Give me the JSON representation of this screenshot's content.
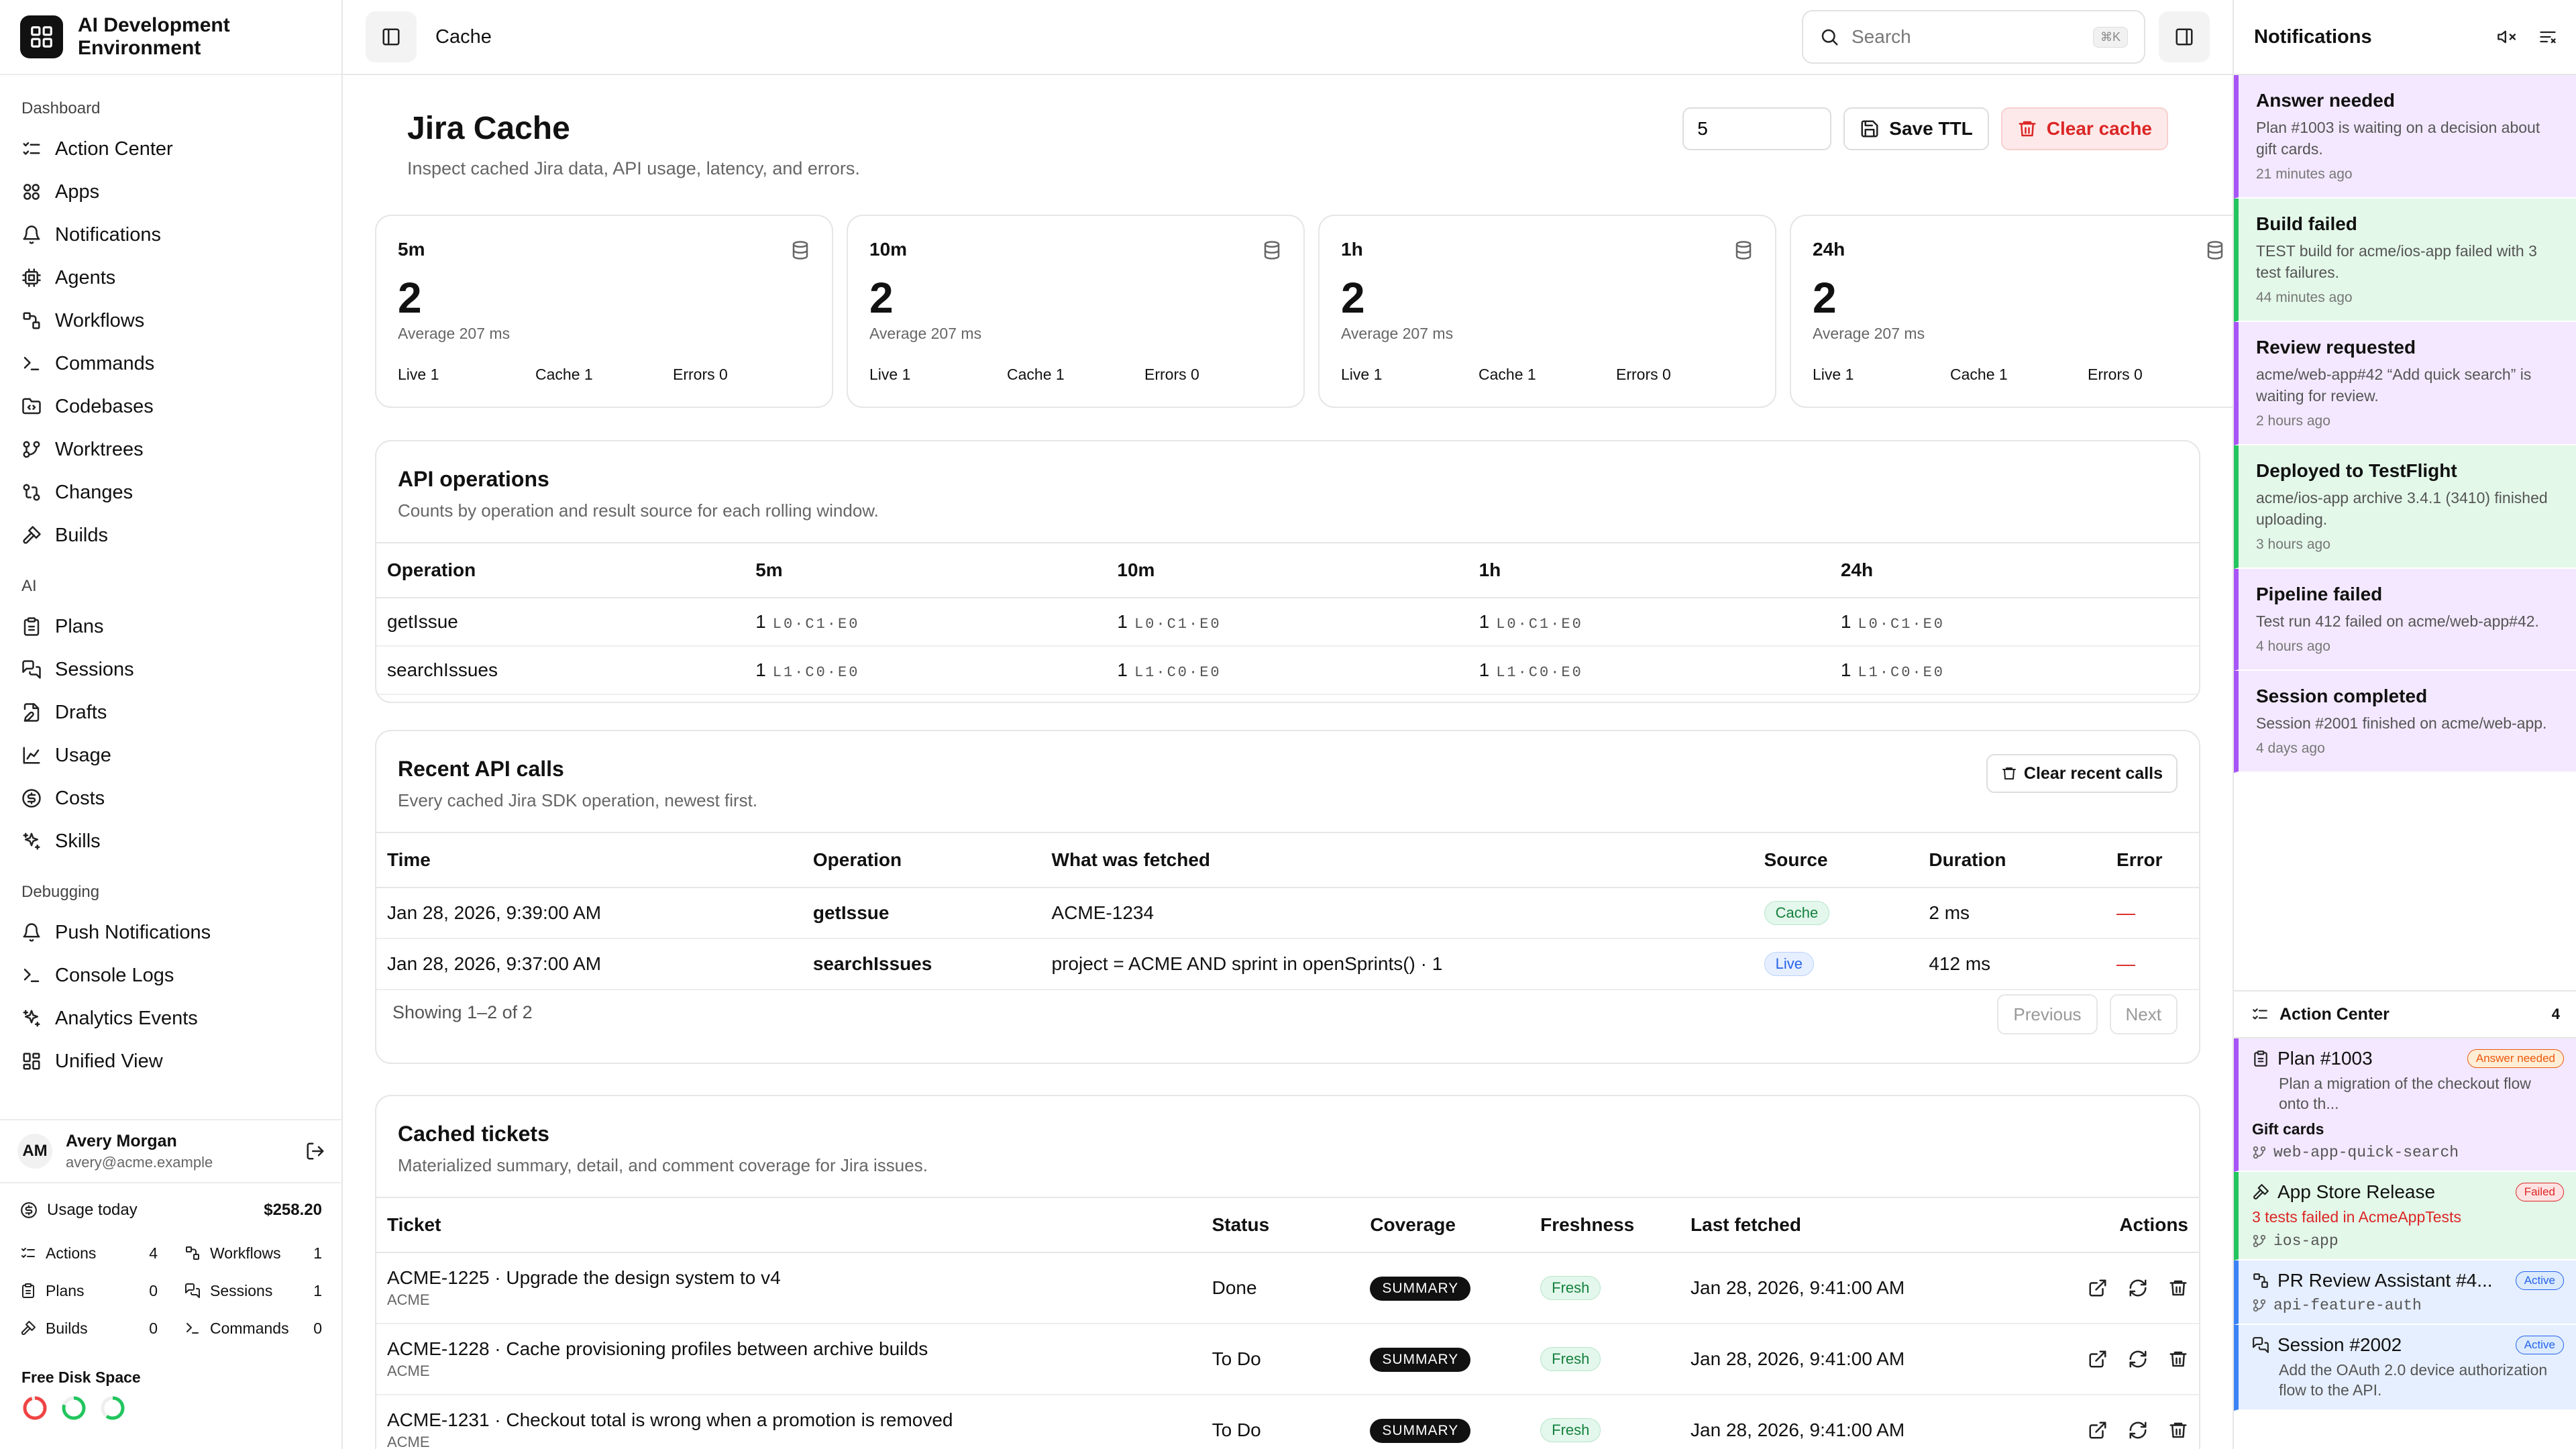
{
  "app": {
    "name": "AI Development Environment"
  },
  "sidebar": {
    "sections": [
      {
        "title": "Dashboard",
        "items": [
          {
            "label": "Action Center",
            "icon": "list-check-icon"
          },
          {
            "label": "Apps",
            "icon": "apps-icon"
          },
          {
            "label": "Notifications",
            "icon": "bell-icon"
          },
          {
            "label": "Agents",
            "icon": "cpu-icon"
          },
          {
            "label": "Workflows",
            "icon": "workflow-icon"
          },
          {
            "label": "Commands",
            "icon": "terminal-icon"
          },
          {
            "label": "Codebases",
            "icon": "folder-code-icon"
          },
          {
            "label": "Worktrees",
            "icon": "git-branch-icon"
          },
          {
            "label": "Changes",
            "icon": "git-compare-icon"
          },
          {
            "label": "Builds",
            "icon": "hammer-icon"
          }
        ]
      },
      {
        "title": "AI",
        "items": [
          {
            "label": "Plans",
            "icon": "clipboard-icon"
          },
          {
            "label": "Sessions",
            "icon": "messages-icon"
          },
          {
            "label": "Drafts",
            "icon": "file-edit-icon"
          },
          {
            "label": "Usage",
            "icon": "chart-icon"
          },
          {
            "label": "Costs",
            "icon": "dollar-icon"
          },
          {
            "label": "Skills",
            "icon": "sparkles-icon"
          }
        ]
      },
      {
        "title": "Debugging",
        "items": [
          {
            "label": "Push Notifications",
            "icon": "bell-icon"
          },
          {
            "label": "Console Logs",
            "icon": "terminal-icon"
          },
          {
            "label": "Analytics Events",
            "icon": "sparkles-icon"
          },
          {
            "label": "Unified View",
            "icon": "layout-icon"
          }
        ]
      }
    ],
    "user": {
      "initials": "AM",
      "name": "Avery Morgan",
      "email": "avery@acme.example"
    },
    "usage": {
      "label": "Usage today",
      "amount": "$258.20",
      "stats": [
        {
          "label": "Actions",
          "value": "4",
          "icon": "list-check-icon"
        },
        {
          "label": "Workflows",
          "value": "1",
          "icon": "workflow-icon"
        },
        {
          "label": "Plans",
          "value": "0",
          "icon": "clipboard-icon"
        },
        {
          "label": "Sessions",
          "value": "1",
          "icon": "messages-icon"
        },
        {
          "label": "Builds",
          "value": "0",
          "icon": "hammer-icon"
        },
        {
          "label": "Commands",
          "value": "0",
          "icon": "terminal-icon"
        }
      ]
    },
    "disk": {
      "label": "Free Disk Space",
      "rings": [
        {
          "color": "#ef4444",
          "fraction": 0.95
        },
        {
          "color": "#22c55e",
          "fraction": 0.8
        },
        {
          "color": "#22c55e",
          "fraction": 0.6
        }
      ]
    }
  },
  "topbar": {
    "breadcrumb": "Cache",
    "search_placeholder": "Search",
    "shortcut": "⌘K"
  },
  "page": {
    "title": "Jira Cache",
    "subtitle": "Inspect cached Jira data, API usage, latency, and errors.",
    "ttl_value": "5",
    "save_ttl": "Save TTL",
    "clear_cache": "Clear cache"
  },
  "cards": [
    {
      "label": "5m",
      "value": "2",
      "avg": "Average 207 ms",
      "live": "Live 1",
      "cache": "Cache 1",
      "errors": "Errors 0"
    },
    {
      "label": "10m",
      "value": "2",
      "avg": "Average 207 ms",
      "live": "Live 1",
      "cache": "Cache 1",
      "errors": "Errors 0"
    },
    {
      "label": "1h",
      "value": "2",
      "avg": "Average 207 ms",
      "live": "Live 1",
      "cache": "Cache 1",
      "errors": "Errors 0"
    },
    {
      "label": "24h",
      "value": "2",
      "avg": "Average 207 ms",
      "live": "Live 1",
      "cache": "Cache 1",
      "errors": "Errors 0"
    }
  ],
  "api_ops": {
    "title": "API operations",
    "subtitle": "Counts by operation and result source for each rolling window.",
    "headers": [
      "Operation",
      "5m",
      "10m",
      "1h",
      "24h"
    ],
    "rows": [
      {
        "op": "getIssue",
        "cells": [
          {
            "n": "1",
            "d": "L0·C1·E0"
          },
          {
            "n": "1",
            "d": "L0·C1·E0"
          },
          {
            "n": "1",
            "d": "L0·C1·E0"
          },
          {
            "n": "1",
            "d": "L0·C1·E0"
          }
        ]
      },
      {
        "op": "searchIssues",
        "cells": [
          {
            "n": "1",
            "d": "L1·C0·E0"
          },
          {
            "n": "1",
            "d": "L1·C0·E0"
          },
          {
            "n": "1",
            "d": "L1·C0·E0"
          },
          {
            "n": "1",
            "d": "L1·C0·E0"
          }
        ]
      }
    ]
  },
  "recent": {
    "title": "Recent API calls",
    "subtitle": "Every cached Jira SDK operation, newest first.",
    "clear_btn": "Clear recent calls",
    "headers": [
      "Time",
      "Operation",
      "What was fetched",
      "Source",
      "Duration",
      "Error"
    ],
    "rows": [
      {
        "time": "Jan 28, 2026, 9:39:00 AM",
        "op": "getIssue",
        "fetched": "ACME-1234",
        "source": "Cache",
        "duration": "2 ms",
        "error": "—"
      },
      {
        "time": "Jan 28, 2026, 9:37:00 AM",
        "op": "searchIssues",
        "fetched": "project = ACME AND sprint in openSprints() · 1",
        "source": "Live",
        "duration": "412 ms",
        "error": "—"
      }
    ],
    "showing": "Showing 1–2 of 2",
    "prev": "Previous",
    "next": "Next"
  },
  "tickets": {
    "title": "Cached tickets",
    "subtitle": "Materialized summary, detail, and comment coverage for Jira issues.",
    "headers": [
      "Ticket",
      "Status",
      "Coverage",
      "Freshness",
      "Last fetched",
      "Actions"
    ],
    "rows": [
      {
        "title": "ACME-1225 · Upgrade the design system to v4",
        "project": "ACME",
        "status": "Done",
        "coverage": "SUMMARY",
        "fresh": "Fresh",
        "fetched": "Jan 28, 2026, 9:41:00 AM"
      },
      {
        "title": "ACME-1228 · Cache provisioning profiles between archive builds",
        "project": "ACME",
        "status": "To Do",
        "coverage": "SUMMARY",
        "fresh": "Fresh",
        "fetched": "Jan 28, 2026, 9:41:00 AM"
      },
      {
        "title": "ACME-1231 · Checkout total is wrong when a promotion is removed",
        "project": "ACME",
        "status": "To Do",
        "coverage": "SUMMARY",
        "fresh": "Fresh",
        "fetched": "Jan 28, 2026, 9:41:00 AM"
      }
    ]
  },
  "notifications": {
    "title": "Notifications",
    "items": [
      {
        "title": "Answer needed",
        "body": "Plan #1003 is waiting on a decision about gift cards.",
        "time": "21 minutes ago",
        "color": "#a855f7",
        "bg": "#f3e8ff"
      },
      {
        "title": "Build failed",
        "body": "TEST build for acme/ios-app failed with 3 test failures.",
        "time": "44 minutes ago",
        "color": "#22c55e",
        "bg": "#e3f8e9"
      },
      {
        "title": "Review requested",
        "body": "acme/web-app#42 “Add quick search” is waiting for review.",
        "time": "2 hours ago",
        "color": "#a855f7",
        "bg": "#f3e8ff"
      },
      {
        "title": "Deployed to TestFlight",
        "body": "acme/ios-app archive 3.4.1 (3410) finished uploading.",
        "time": "3 hours ago",
        "color": "#22c55e",
        "bg": "#e3f8e9"
      },
      {
        "title": "Pipeline failed",
        "body": "Test run 412 failed on acme/web-app#42.",
        "time": "4 hours ago",
        "color": "#a855f7",
        "bg": "#f3e8ff"
      },
      {
        "title": "Session completed",
        "body": "Session #2001 finished on acme/web-app.",
        "time": "4 days ago",
        "color": "#a855f7",
        "bg": "#f3e8ff"
      }
    ]
  },
  "action_center": {
    "title": "Action Center",
    "count": "4",
    "items": [
      {
        "title": "Plan #1003",
        "pill": "Answer needed",
        "pill_color": "#ea580c",
        "pill_bg": "#ffedd5",
        "body": "Plan a migration of the checkout flow onto th...",
        "extra": "Gift cards",
        "branch": "web-app-quick-search",
        "color": "#a855f7",
        "bg": "#f3e8ff",
        "icon": "clipboard-icon"
      },
      {
        "title": "App Store Release",
        "pill": "Failed",
        "pill_color": "#dc2626",
        "pill_bg": "#fee2e2",
        "body": "3 tests failed in AcmeAppTests",
        "branch": "ios-app",
        "color": "#22c55e",
        "bg": "#e3f8e9",
        "icon": "hammer-icon"
      },
      {
        "title": "PR Review Assistant #4...",
        "pill": "Active",
        "pill_color": "#2563eb",
        "pill_bg": "#dbeafe",
        "branch": "api-feature-auth",
        "color": "#3b82f6",
        "bg": "#e6efff",
        "icon": "workflow-icon"
      },
      {
        "title": "Session #2002",
        "pill": "Active",
        "pill_color": "#2563eb",
        "pill_bg": "#dbeafe",
        "body": "Add the OAuth 2.0 device authorization flow to the API.",
        "color": "#3b82f6",
        "bg": "#e6efff",
        "icon": "messages-icon"
      }
    ]
  }
}
